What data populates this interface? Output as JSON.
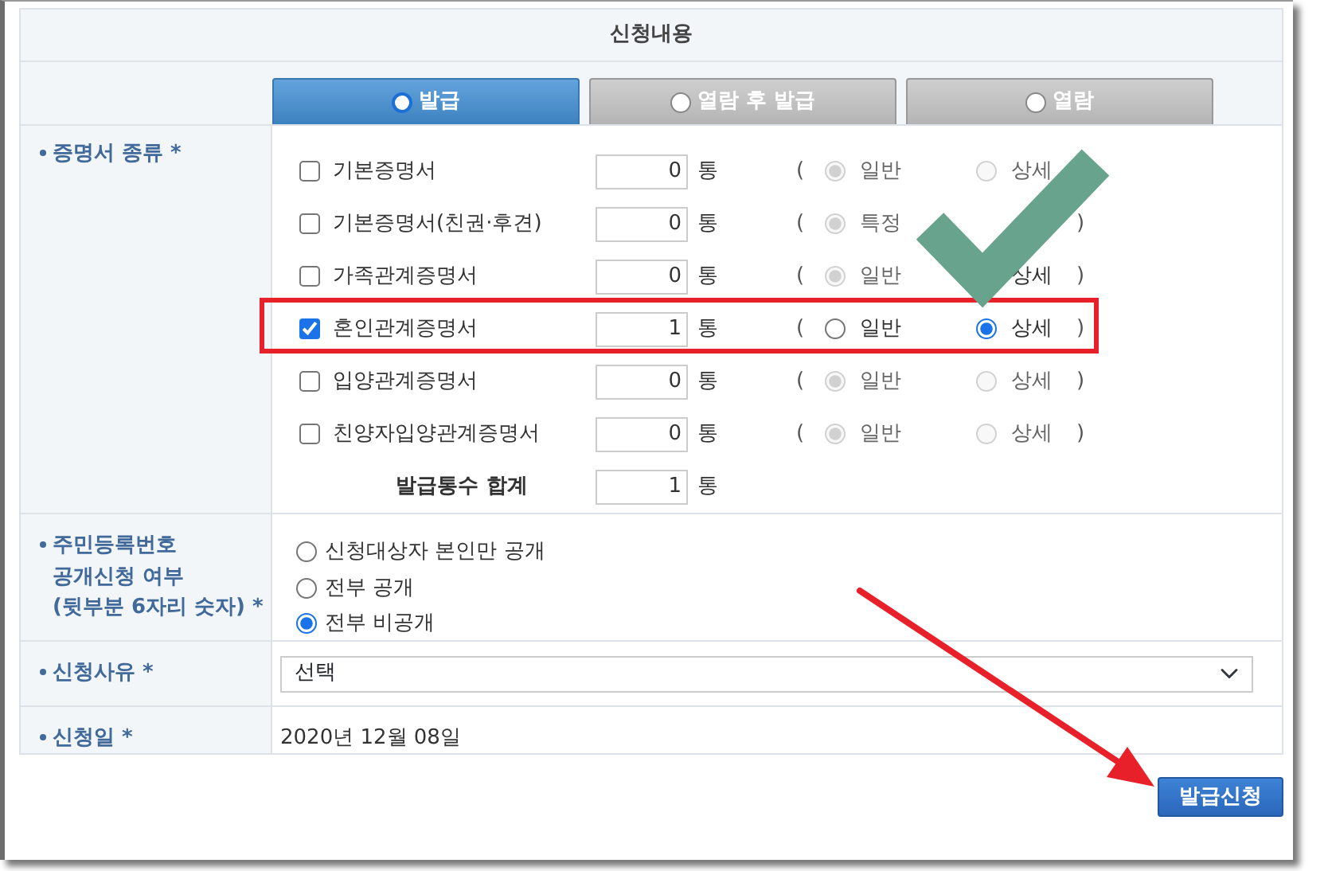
{
  "header": "신청내용",
  "tabs": [
    {
      "label": "발급",
      "selected": true
    },
    {
      "label": "열람 후 발급",
      "selected": false
    },
    {
      "label": "열람",
      "selected": false
    }
  ],
  "certificate_section": {
    "label": "증명서 종류 *",
    "items": [
      {
        "name": "기본증명서",
        "checked": false,
        "count": "0",
        "unit": "통",
        "open": "(",
        "options": [
          {
            "label": "일반",
            "selected": true,
            "disabled": true
          },
          {
            "label": "상세",
            "selected": false,
            "disabled": true
          }
        ]
      },
      {
        "name": "기본증명서(친권·후견)",
        "checked": false,
        "count": "0",
        "unit": "통",
        "open": "(",
        "options": [
          {
            "label": "특정",
            "selected": true,
            "disabled": true
          }
        ],
        "close": ")"
      },
      {
        "name": "가족관계증명서",
        "checked": false,
        "count": "0",
        "unit": "통",
        "open": "(",
        "options": [
          {
            "label": "일반",
            "selected": true,
            "disabled": true
          },
          {
            "label": "상세"
          }
        ],
        "close": ")"
      },
      {
        "name": "혼인관계증명서",
        "checked": true,
        "count": "1",
        "unit": "통",
        "open": "(",
        "options": [
          {
            "label": "일반",
            "selected": false,
            "disabled": false
          },
          {
            "label": "상세",
            "selected": true,
            "disabled": false
          }
        ],
        "close": ")"
      },
      {
        "name": "입양관계증명서",
        "checked": false,
        "count": "0",
        "unit": "통",
        "open": "(",
        "options": [
          {
            "label": "일반",
            "selected": true,
            "disabled": true
          },
          {
            "label": "상세",
            "selected": false,
            "disabled": true
          }
        ],
        "close": ")"
      },
      {
        "name": "친양자입양관계증명서",
        "checked": false,
        "count": "0",
        "unit": "통",
        "open": "(",
        "options": [
          {
            "label": "일반",
            "selected": true,
            "disabled": true
          },
          {
            "label": "상세",
            "selected": false,
            "disabled": true
          }
        ],
        "close": ")"
      }
    ],
    "total": {
      "label": "발급통수 합계",
      "count": "1",
      "unit": "통"
    }
  },
  "resident_number_section": {
    "label_lines": [
      "주민등록번호",
      "공개신청 여부",
      "(뒷부분 6자리 숫자) *"
    ],
    "options": [
      {
        "label": "신청대상자 본인만 공개",
        "selected": false
      },
      {
        "label": "전부 공개",
        "selected": false
      },
      {
        "label": "전부 비공개",
        "selected": true
      }
    ]
  },
  "reason_section": {
    "label": "신청사유 *",
    "value": "선택"
  },
  "date_section": {
    "label": "신청일 *",
    "value": "2020년 12월 08일"
  },
  "submit_button": "발급신청",
  "annotations": [
    {
      "kind": "box",
      "color": "#e8202a"
    },
    {
      "kind": "check",
      "color": "#68a38e"
    },
    {
      "kind": "arrow",
      "color": "#e8202a"
    }
  ]
}
